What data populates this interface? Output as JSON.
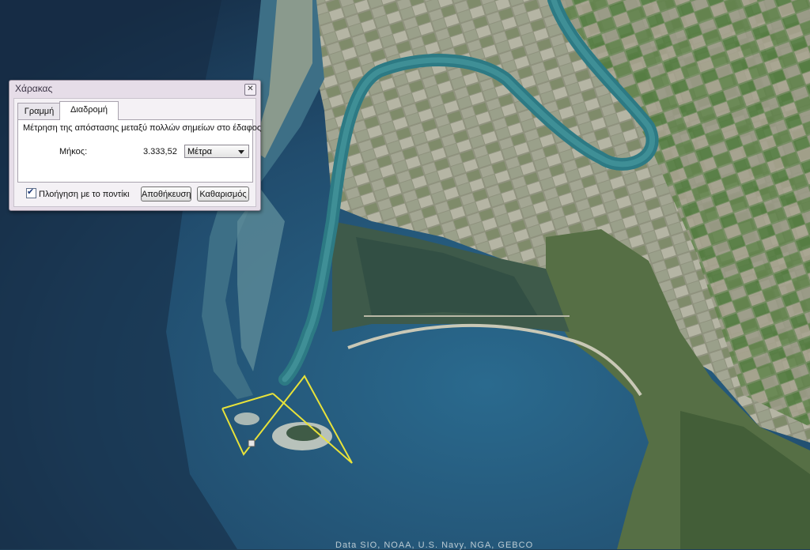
{
  "map": {
    "attribution": "Data SIO, NOAA, U.S. Navy, NGA, GEBCO",
    "path_color": "#e8e23a"
  },
  "ruler_dialog": {
    "title": "Χάρακας",
    "close_icon": "close-icon",
    "tabs": [
      {
        "label": "Γραμμή",
        "active": false
      },
      {
        "label": "Διαδρομή",
        "active": true
      }
    ],
    "description": "Μέτρηση της απόστασης μεταξύ πολλών σημείων στο έδαφος",
    "length_label": "Μήκος:",
    "length_value": "3.333,52",
    "unit_selected": "Μέτρα",
    "mouse_nav_label": "Πλοήγηση με το ποντίκι",
    "mouse_nav_checked": true,
    "save_label": "Αποθήκευση",
    "clear_label": "Καθαρισμός"
  }
}
